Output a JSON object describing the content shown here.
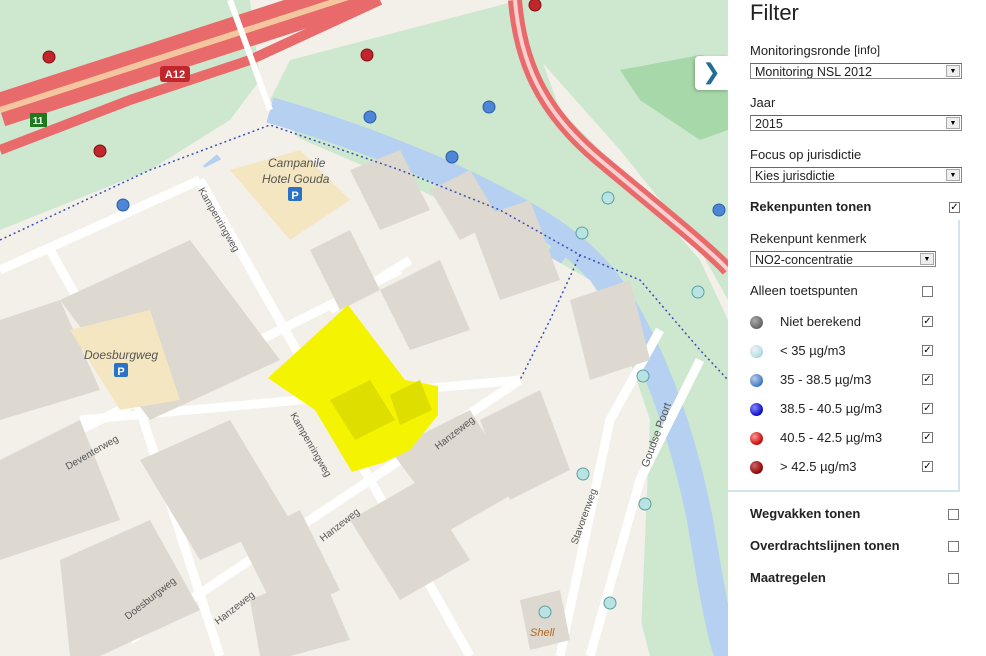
{
  "panel": {
    "title": "Filter",
    "toggle_icon": "chevron-right-icon",
    "monitoringsronde": {
      "label": "Monitoringsronde",
      "info": "[info]",
      "value": "Monitoring NSL 2012"
    },
    "jaar": {
      "label": "Jaar",
      "value": "2015"
    },
    "jurisdictie": {
      "label": "Focus op jurisdictie",
      "value": "Kies jurisdictie"
    },
    "rekenpunten": {
      "label": "Rekenpunten tonen",
      "checked": true
    },
    "kenmerk": {
      "label": "Rekenpunt kenmerk",
      "value": "NO2-concentratie"
    },
    "toetspunten": {
      "label": "Alleen toetspunten",
      "checked": false
    },
    "legend": [
      {
        "label": "Niet berekend",
        "color": "#6e6e6e",
        "checked": true
      },
      {
        "label": "< 35 µg/m3",
        "color": "#b9e3e3",
        "checked": true
      },
      {
        "label": "35 - 38.5 µg/m3",
        "color": "#4d86d6",
        "checked": true
      },
      {
        "label": "38.5 - 40.5 µg/m3",
        "color": "#1a1ad0",
        "checked": true
      },
      {
        "label": "40.5 - 42.5 µg/m3",
        "color": "#d01a1a",
        "checked": true
      },
      {
        "label": "> 42.5 µg/m3",
        "color": "#9a1010",
        "checked": true
      }
    ],
    "wegvakken": {
      "label": "Wegvakken tonen",
      "checked": false
    },
    "overdrachtslijnen": {
      "label": "Overdrachtslijnen tonen",
      "checked": false
    },
    "maatregelen": {
      "label": "Maatregelen",
      "checked": false
    }
  },
  "map": {
    "labels": {
      "a12": "A12",
      "exit": "11",
      "hotel": "Campanile\nHotel Gouda",
      "doesburgweg_poi": "Doesburgweg",
      "kampenringweg": "Kampenringweg",
      "hanzeweg": "Hanzeweg",
      "deventerweg": "Deventerweg",
      "doesburgweg": "Doesburgweg",
      "goudse_poort": "Goudse Poort",
      "stavorenweg": "Stavorenweg",
      "shell": "Shell",
      "parking": "P"
    },
    "colors": {
      "water": "#b5d0f0",
      "park": "#cde8cf",
      "highway": "#e86a6a",
      "highlight": "#f4f400"
    }
  }
}
